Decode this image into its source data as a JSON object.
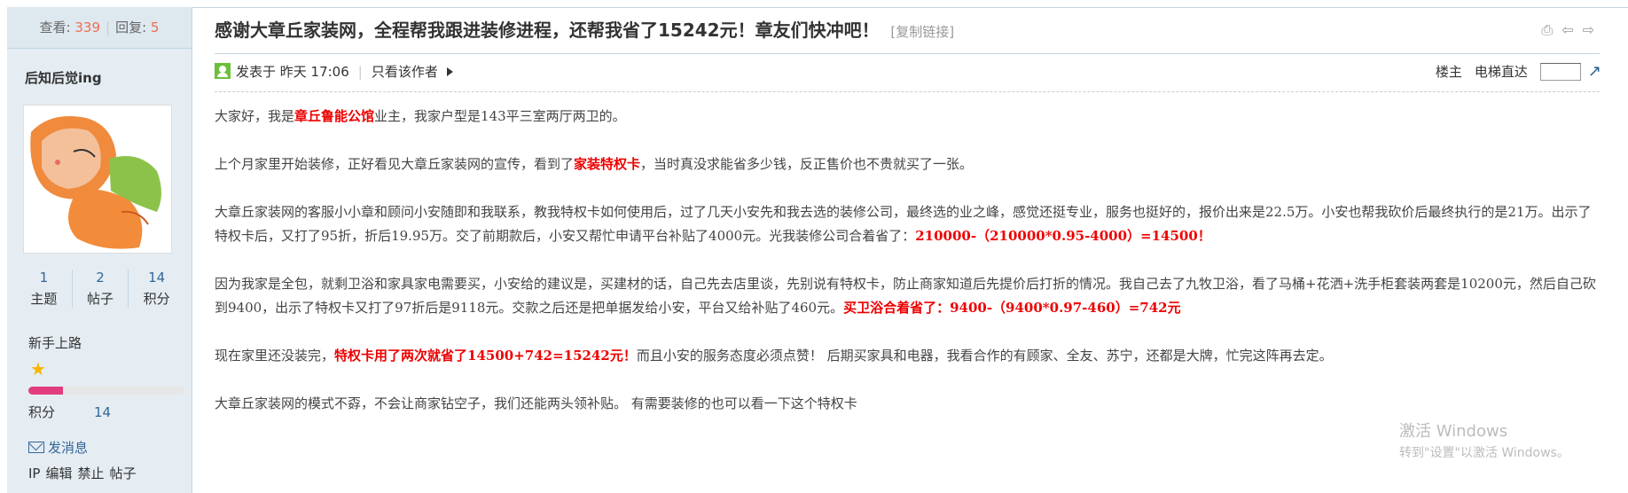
{
  "sidebar": {
    "views_label": "查看:",
    "views": "339",
    "replies_label": "回复:",
    "replies": "5",
    "username": "后知后觉ing",
    "counts": [
      {
        "value": "1",
        "label": "主题"
      },
      {
        "value": "2",
        "label": "帖子"
      },
      {
        "value": "14",
        "label": "积分"
      }
    ],
    "rank": "新手上路",
    "rank_progress": 0.22,
    "points_label": "积分",
    "points_value": "14",
    "message_label": "发消息",
    "admin_links": [
      "IP",
      "编辑",
      "禁止",
      "帖子"
    ]
  },
  "thread": {
    "title": "感谢大章丘家装网，全程帮我跟进装修进程，还帮我省了15242元！章友们快冲吧！",
    "copy_link": "[复制链接]",
    "posted": "发表于 昨天 17:06",
    "only_author": "只看该作者",
    "floor_label": "楼主",
    "elevator_label": "电梯直达"
  },
  "post": {
    "p1_a": "大家好，我是",
    "p1_red": "章丘鲁能公馆",
    "p1_b": "业主，我家户型是143平三室两厅两卫的。",
    "p2_a": "上个月家里开始装修，正好看见大章丘家装网的宣传，看到了",
    "p2_red": "家装特权卡",
    "p2_b": "，当时真没求能省多少钱，反正售价也不贵就买了一张。",
    "p3_a": "大章丘家装网的客服小小章和顾问小安随即和我联系，教我特权卡如何使用后，过了几天小安先和我去选的装修公司，最终选的业之峰，感觉还挺专业，服务也挺好的，报价出来是22.5万。小安也帮我砍价后最终执行的是21万。出示了特权卡后，又打了95折，折后19.95万。交了前期款后，小安又帮忙申请平台补贴了4000元。光我装修公司合着省了：",
    "p3_red": "210000-（210000*0.95-4000）=14500！",
    "p4_a": "因为我家是全包，就剩卫浴和家具家电需要买，小安给的建议是，买建材的话，自己先去店里谈，先别说有特权卡，防止商家知道后先提价后打折的情况。我自己去了九牧卫浴，看了马桶+花洒+洗手柜套装两套是10200元，然后自己砍到9400，出示了特权卡又打了97折后是9118元。交款之后还是把单据发给小安，平台又给补贴了460元。",
    "p4_red": "买卫浴合着省了：9400-（9400*0.97-460）=742元",
    "p5_a": "现在家里还没装完，",
    "p5_red": "特权卡用了两次就省了14500+742=15242元！",
    "p5_b": "而且小安的服务态度必须点赞！ 后期买家具和电器，我看合作的有顾家、全友、苏宁，还都是大牌，忙完这阵再去定。",
    "p6": "大章丘家装网的模式不孬，不会让商家钻空子，我们还能两头领补贴。 有需要装修的也可以看一下这个特权卡"
  },
  "watermark": {
    "line1": "激活 Windows",
    "line2": "转到\"设置\"以激活 Windows。"
  }
}
